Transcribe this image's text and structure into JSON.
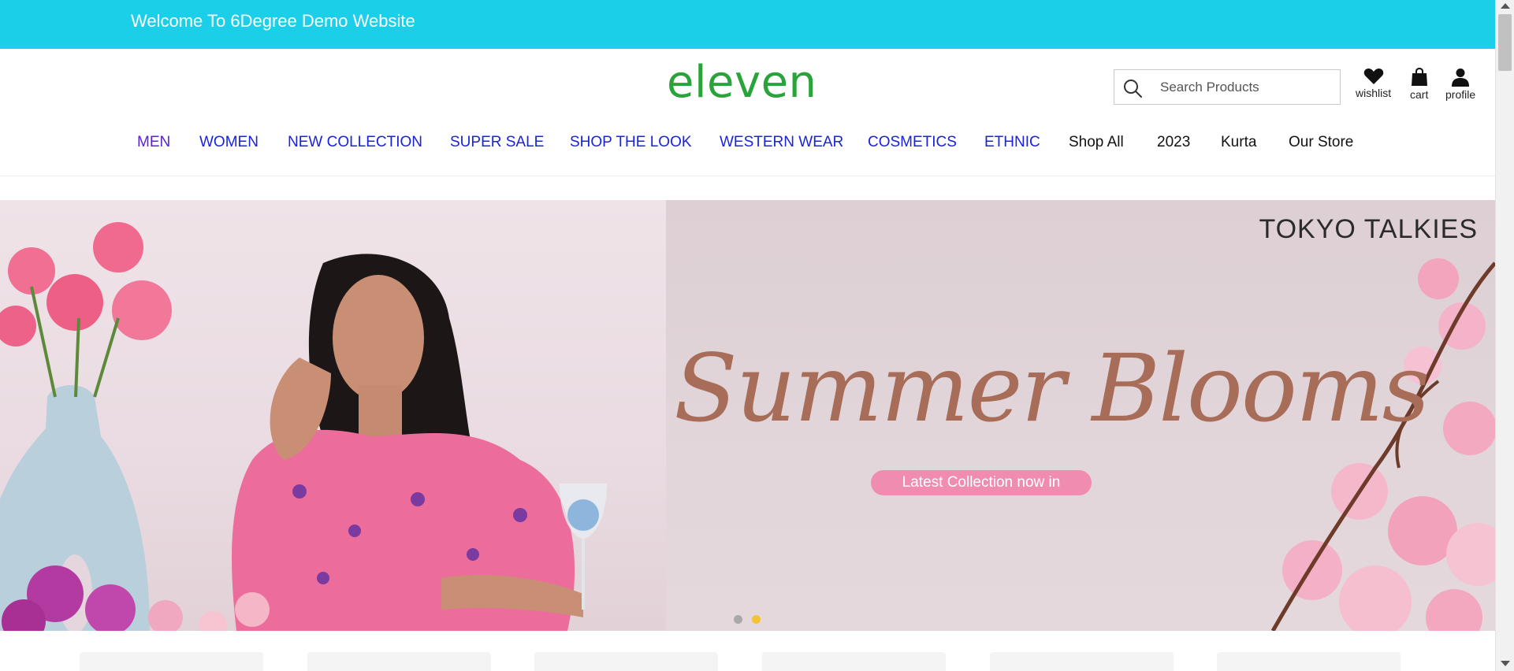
{
  "topbar": {
    "welcome_text": "Welcome To 6Degree Demo Website",
    "bg_color": "#1bcfe8"
  },
  "header": {
    "logo_text": "eleven",
    "logo_color": "#2aa33a",
    "search": {
      "placeholder": "Search Products",
      "icon": "search-icon"
    },
    "icons": [
      {
        "label": "wishlist",
        "icon": "heart-icon"
      },
      {
        "label": "cart",
        "icon": "shopping-bag-icon"
      },
      {
        "label": "profile",
        "icon": "user-icon"
      }
    ]
  },
  "nav": {
    "items": [
      {
        "label": "MEN",
        "color": "#5a21d6"
      },
      {
        "label": "WOMEN",
        "color": "#1a22e0"
      },
      {
        "label": "NEW COLLECTION",
        "color": "#1a22e0"
      },
      {
        "label": "SUPER SALE",
        "color": "#1a22e0"
      },
      {
        "label": "SHOP THE LOOK",
        "color": "#1a22e0"
      },
      {
        "label": "WESTERN WEAR",
        "color": "#1a22e0"
      },
      {
        "label": "COSMETICS",
        "color": "#1a22e0"
      },
      {
        "label": "ETHNIC",
        "color": "#1a22e0"
      },
      {
        "label": "Shop All",
        "color": "#111111"
      },
      {
        "label": "2023",
        "color": "#111111"
      },
      {
        "label": "Kurta",
        "color": "#111111"
      },
      {
        "label": "Our Store",
        "color": "#111111"
      }
    ]
  },
  "banner": {
    "brand": "TOKYO TALKIES",
    "headline": "Summer Blooms",
    "cta": "Latest Collection now in",
    "slides": 2,
    "active_slide": 2,
    "dot_colors": {
      "inactive": "#a9a9a9",
      "active": "#f2c334"
    }
  }
}
